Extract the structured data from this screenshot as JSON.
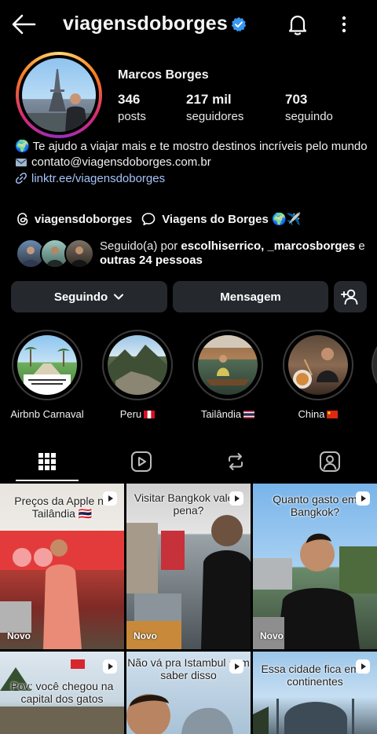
{
  "header": {
    "username": "viagensdoborges",
    "back_icon": "arrow-left-icon",
    "verified_icon": "verified-badge-icon",
    "bell_icon": "bell-icon",
    "more_icon": "more-vertical-icon"
  },
  "profile": {
    "full_name": "Marcos Borges",
    "stats": [
      {
        "value": "346",
        "label": "posts"
      },
      {
        "value": "217 mil",
        "label": "seguidores"
      },
      {
        "value": "703",
        "label": "seguindo"
      }
    ],
    "bio": {
      "line1": "🌍 Te ajudo a viajar mais e te mostro destinos incríveis pelo mundo",
      "email": "contato@viagensdoborges.com.br",
      "link": "linktr.ee/viagensdoborges"
    },
    "threads_handle": "viagensdoborges",
    "channel_name": "Viagens do Borges 🌍✈️",
    "followed_by": {
      "prefix": "Seguido(a) por ",
      "names": "escolhiserrico, _marcosborges",
      "suffix_connector": "e ",
      "others": "outras 24 pessoas"
    }
  },
  "actions": {
    "following_label": "Seguindo",
    "message_label": "Mensagem",
    "add_user_icon": "add-person-icon"
  },
  "highlights": [
    {
      "label": "Airbnb Carnaval"
    },
    {
      "label": "Peru"
    },
    {
      "label": "Tailândia"
    },
    {
      "label": "China"
    }
  ],
  "tabs": [
    {
      "name": "grid-icon",
      "active": true
    },
    {
      "name": "reels-icon",
      "active": false
    },
    {
      "name": "reposts-icon",
      "active": false
    },
    {
      "name": "tagged-icon",
      "active": false
    }
  ],
  "posts": [
    {
      "caption": "Preços da Apple na Tailândia 🇹🇭",
      "badge": "Novo"
    },
    {
      "caption": "Visitar Bangkok vale a pena?",
      "badge": "Novo"
    },
    {
      "caption": "Quanto gasto em Bangkok?",
      "badge": "Novo"
    },
    {
      "caption": "Pov: você chegou na capital dos gatos",
      "badge": ""
    },
    {
      "caption": "Não vá pra Istambul sem saber disso",
      "badge": ""
    },
    {
      "caption": "Essa cidade fica em 2 continentes",
      "badge": ""
    }
  ],
  "colors": {
    "background": "#000000",
    "button": "#25292e",
    "link": "#a4c2f7",
    "verified": "#3897f0"
  }
}
